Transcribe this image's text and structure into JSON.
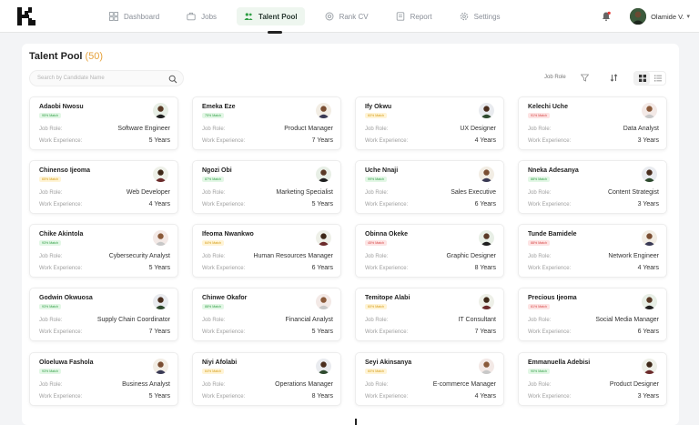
{
  "nav": {
    "items": [
      {
        "label": "Dashboard",
        "icon": "dashboard-icon"
      },
      {
        "label": "Jobs",
        "icon": "briefcase-icon"
      },
      {
        "label": "Talent Pool",
        "icon": "users-icon",
        "active": true
      },
      {
        "label": "Rank CV",
        "icon": "rank-icon"
      },
      {
        "label": "Report",
        "icon": "report-icon"
      },
      {
        "label": "Settings",
        "icon": "gear-icon"
      }
    ],
    "user_name": "Olamide V."
  },
  "page": {
    "title": "Talent Pool",
    "count": "(50)",
    "search_placeholder": "Search by Candidate Name",
    "filter_label": "Job Role"
  },
  "colors": {
    "accent": "#2f9e44",
    "count": "#e6a23c",
    "match_high": "#2f9e44",
    "match_mid": "#d49b12",
    "match_low": "#d64545"
  },
  "labels": {
    "job_role": "Job Role:",
    "work_experience": "Work Experience:"
  },
  "candidates": [
    {
      "name": "Adaobi Nwosu",
      "match": "95% Match",
      "level": "green",
      "role": "Software Engineer",
      "experience": "5 Years"
    },
    {
      "name": "Emeka Eze",
      "match": "75% Match",
      "level": "green",
      "role": "Product Manager",
      "experience": "7 Years"
    },
    {
      "name": "Ify Okwu",
      "match": "60% Match",
      "level": "yellow",
      "role": "UX Designer",
      "experience": "4 Years"
    },
    {
      "name": "Kelechi Uche",
      "match": "91% Match",
      "level": "red",
      "role": "Data Analyst",
      "experience": "3 Years"
    },
    {
      "name": "Chinenso Ijeoma",
      "match": "65% Match",
      "level": "yellow",
      "role": "Web Developer",
      "experience": "4 Years"
    },
    {
      "name": "Ngozi Obi",
      "match": "87% Match",
      "level": "green",
      "role": "Marketing Specialist",
      "experience": "5 Years"
    },
    {
      "name": "Uche Nnaji",
      "match": "99% Match",
      "level": "green",
      "role": "Sales Executive",
      "experience": "6 Years"
    },
    {
      "name": "Nneka Adesanya",
      "match": "88% Match",
      "level": "green",
      "role": "Content Strategist",
      "experience": "3 Years"
    },
    {
      "name": "Chike Akintola",
      "match": "93% Match",
      "level": "green",
      "role": "Cybersecurity Analyst",
      "experience": "5 Years"
    },
    {
      "name": "Ifeoma Nwankwo",
      "match": "64% Match",
      "level": "yellow",
      "role": "Human Resources Manager",
      "experience": "6 Years"
    },
    {
      "name": "Obinna Okeke",
      "match": "45% Match",
      "level": "red",
      "role": "Graphic Designer",
      "experience": "8 Years"
    },
    {
      "name": "Tunde Bamidele",
      "match": "88% Match",
      "level": "red",
      "role": "Network Engineer",
      "experience": "4 Years"
    },
    {
      "name": "Godwin Okwuosa",
      "match": "93% Match",
      "level": "green",
      "role": "Supply Chain Coordinator",
      "experience": "7 Years"
    },
    {
      "name": "Chinwe Okafor",
      "match": "88% Match",
      "level": "green",
      "role": "Financial Analyst",
      "experience": "5 Years"
    },
    {
      "name": "Temitope Alabi",
      "match": "60% Match",
      "level": "yellow",
      "role": "IT Consultant",
      "experience": "7 Years"
    },
    {
      "name": "Precious Ijeoma",
      "match": "61% Match",
      "level": "red",
      "role": "Social Media Manager",
      "experience": "6 Years"
    },
    {
      "name": "Oloeluwa Fashola",
      "match": "93% Match",
      "level": "green",
      "role": "Business Analyst",
      "experience": "5 Years"
    },
    {
      "name": "Niyi Afolabi",
      "match": "64% Match",
      "level": "yellow",
      "role": "Operations Manager",
      "experience": "8 Years"
    },
    {
      "name": "Seyi Akinsanya",
      "match": "60% Match",
      "level": "yellow",
      "role": "E-commerce Manager",
      "experience": "4 Years"
    },
    {
      "name": "Emmanuella Adebisi",
      "match": "90% Match",
      "level": "green",
      "role": "Product Designer",
      "experience": "3 Years"
    }
  ]
}
